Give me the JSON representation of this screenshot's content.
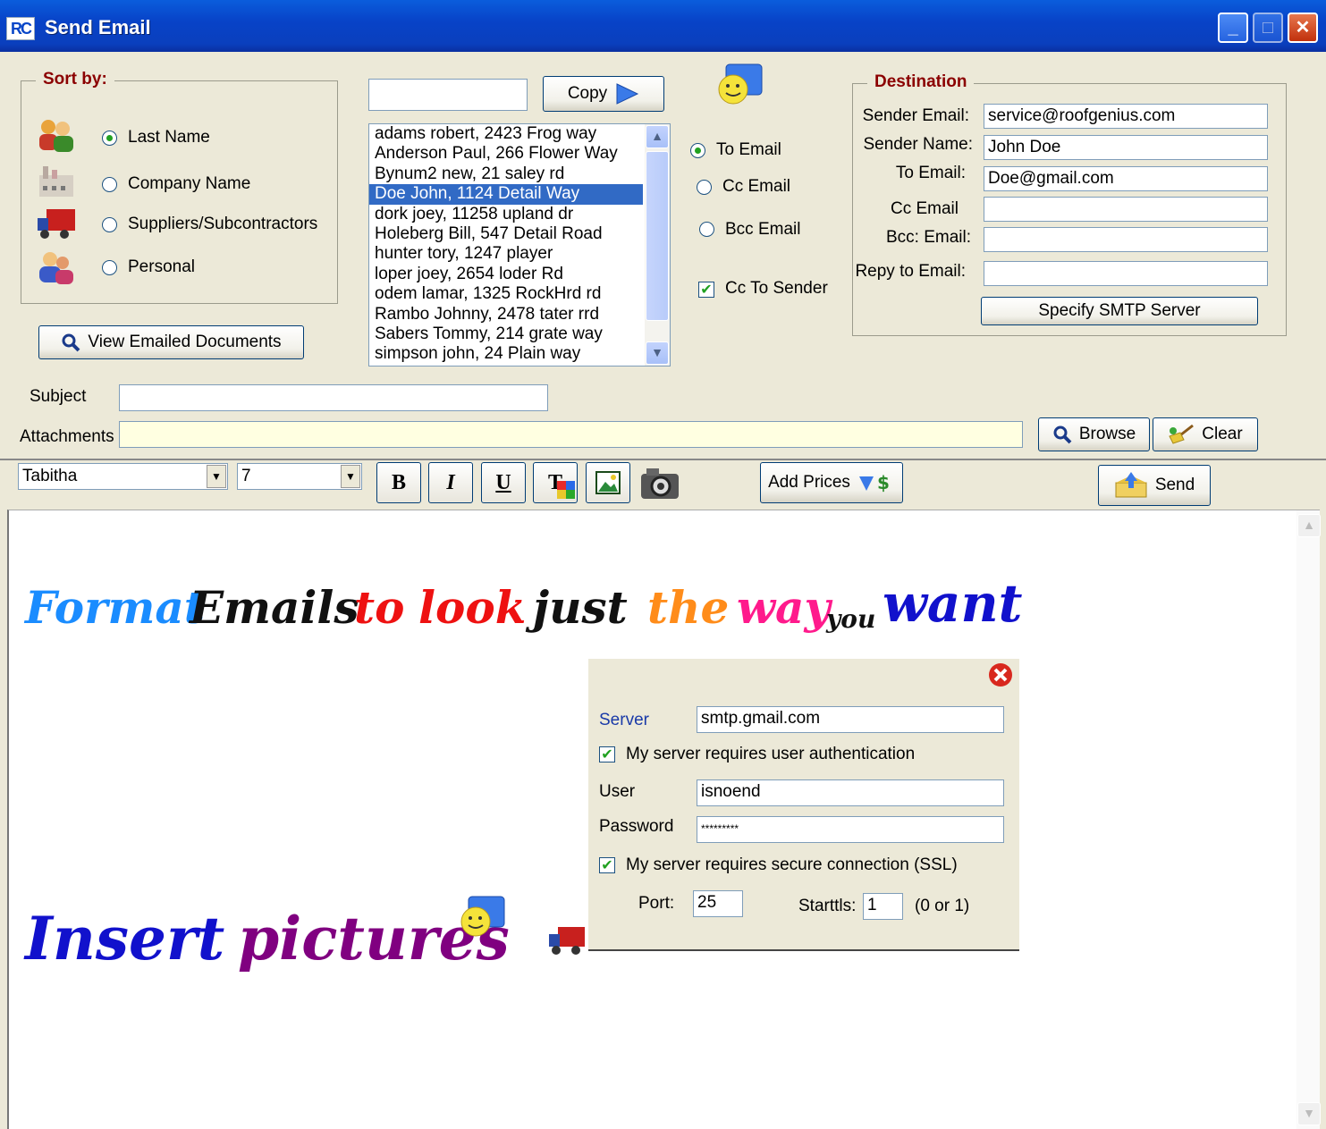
{
  "window": {
    "title": "Send Email",
    "app_icon": "RC",
    "controls": [
      "minimize-icon",
      "maximize-icon",
      "close-icon"
    ]
  },
  "sort": {
    "legend": "Sort by:",
    "options": [
      {
        "label": "Last Name",
        "icon": "people-icon",
        "selected": true
      },
      {
        "label": "Company Name",
        "icon": "factory-icon",
        "selected": false
      },
      {
        "label": "Suppliers/Subcontractors",
        "icon": "truck-icon",
        "selected": false
      },
      {
        "label": "Personal",
        "icon": "person-icon",
        "selected": false
      }
    ]
  },
  "view_docs_button": "View Emailed Documents",
  "copy": {
    "input_value": "",
    "button": "Copy"
  },
  "contacts": [
    "adams robert, 2423 Frog way",
    "Anderson Paul, 266 Flower Way",
    "Bynum2 new, 21 saley rd",
    "Doe John, 1124 Detail Way",
    "dork joey, 11258 upland dr",
    "Holeberg Bill, 547 Detail Road",
    "hunter tory, 1247 player",
    "loper joey, 2654 loder Rd",
    "odem lamar, 1325 RockHrd rd",
    "Rambo Johnny, 2478 tater rrd",
    "Sabers Tommy, 214 grate way",
    "simpson john, 24 Plain way"
  ],
  "selected_contact_index": 3,
  "recipient_type": {
    "options": [
      {
        "label": "To Email",
        "selected": true
      },
      {
        "label": "Cc Email",
        "selected": false
      },
      {
        "label": "Bcc Email",
        "selected": false
      }
    ],
    "cc_sender": {
      "label": "Cc To Sender",
      "checked": true
    }
  },
  "destination": {
    "legend": "Destination",
    "fields": [
      {
        "label": "Sender Email:",
        "value": "service@roofgenius.com"
      },
      {
        "label": "Sender Name:",
        "value": "John Doe"
      },
      {
        "label": "To Email:",
        "value": "Doe@gmail.com"
      },
      {
        "label": "Cc Email",
        "value": ""
      },
      {
        "label": "Bcc: Email:",
        "value": ""
      },
      {
        "label": "Repy to Email:",
        "value": ""
      }
    ],
    "smtp_button": "Specify SMTP Server"
  },
  "subject": {
    "label": "Subject",
    "value": ""
  },
  "attachments": {
    "label": "Attachments",
    "value": ""
  },
  "browse_button": "Browse",
  "clear_button": "Clear",
  "toolbar": {
    "font": "Tabitha",
    "size": "7",
    "bold": "B",
    "italic": "I",
    "underline": "U",
    "text_color": "T",
    "add_prices": "Add Prices",
    "send": "Send"
  },
  "editor": {
    "line1": [
      {
        "text": "Format",
        "color": "#1a8cff"
      },
      {
        "text": "Emails",
        "color": "#111111"
      },
      {
        "text": "to",
        "color": "#ee1111"
      },
      {
        "text": "look",
        "color": "#ee1111"
      },
      {
        "text": "just",
        "color": "#111111"
      },
      {
        "text": "the",
        "color": "#ff8c1a"
      },
      {
        "text": "way",
        "color": "#ff1a8c"
      },
      {
        "text": "you",
        "color": "#111111"
      },
      {
        "text": "want",
        "color": "#1111cc"
      }
    ],
    "line2": [
      {
        "text": "Insert",
        "color": "#1111cc"
      },
      {
        "text": "pictures",
        "color": "#800080"
      }
    ]
  },
  "smtp_panel": {
    "server_label": "Server",
    "server_value": "smtp.gmail.com",
    "auth_label": "My server requires user authentication",
    "auth_checked": true,
    "user_label": "User",
    "user_value": "isnoend",
    "password_label": "Password",
    "password_value": "*********",
    "ssl_label": "My server requires secure connection (SSL)",
    "ssl_checked": true,
    "port_label": "Port:",
    "port_value": "25",
    "starttls_label": "Starttls:",
    "starttls_value": "1",
    "starttls_hint": "(0 or 1)"
  }
}
